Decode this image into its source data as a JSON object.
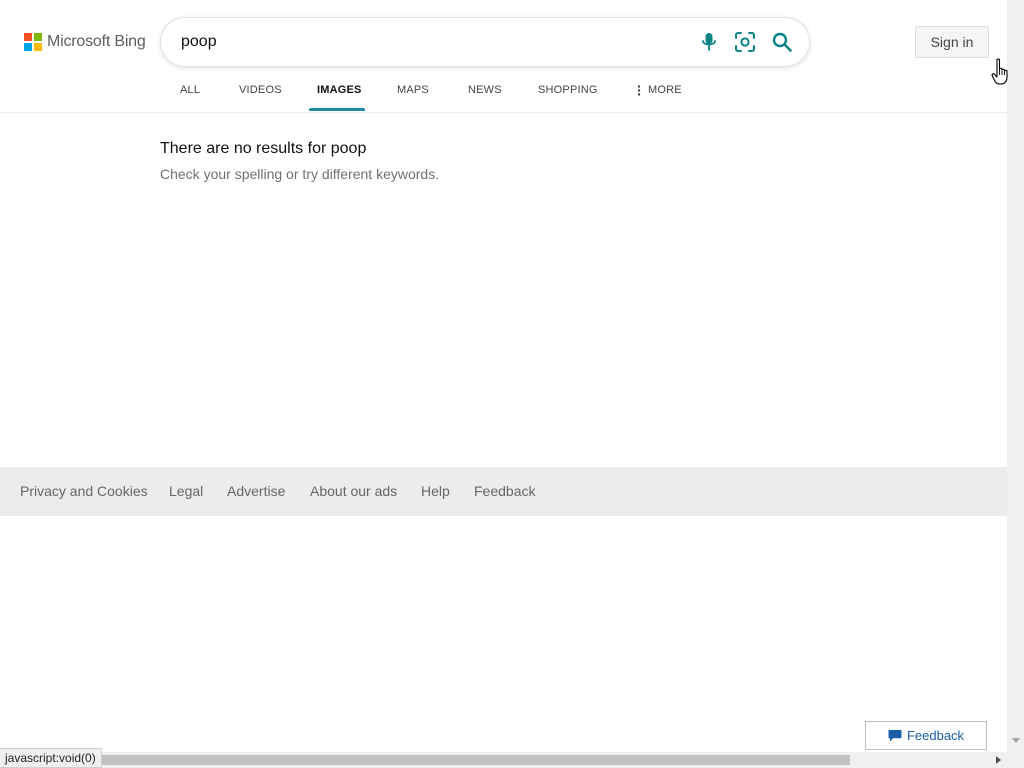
{
  "brand": {
    "name": "Microsoft Bing",
    "logo_colors": [
      "#f25022",
      "#7fba00",
      "#00a4ef",
      "#ffb900"
    ]
  },
  "search": {
    "query": "poop",
    "icons": [
      "microphone-icon",
      "visual-search-icon",
      "search-icon"
    ]
  },
  "header": {
    "sign_in_label": "Sign in"
  },
  "nav": {
    "items": [
      {
        "label": "ALL",
        "active": false
      },
      {
        "label": "VIDEOS",
        "active": false
      },
      {
        "label": "IMAGES",
        "active": true
      },
      {
        "label": "MAPS",
        "active": false
      },
      {
        "label": "NEWS",
        "active": false
      },
      {
        "label": "SHOPPING",
        "active": false
      },
      {
        "label": "MORE",
        "active": false
      }
    ],
    "accent_color": "#1a8ca3"
  },
  "results": {
    "message": "There are no results for poop",
    "hint": "Check your spelling or try different keywords."
  },
  "footer": {
    "links": [
      "Privacy and Cookies",
      "Legal",
      "Advertise",
      "About our ads",
      "Help",
      "Feedback"
    ]
  },
  "feedback_button": {
    "label": "Feedback",
    "icon": "chat-bubble-icon"
  },
  "status_bar": {
    "text": "javascript:void(0)"
  }
}
